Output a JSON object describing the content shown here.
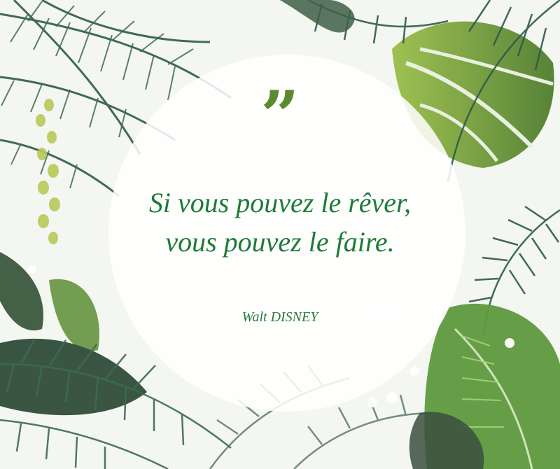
{
  "quote": {
    "mark": "”",
    "lines": [
      "Si vous pouvez le rêver,",
      "vous pouvez le faire."
    ],
    "author": "Walt DISNEY"
  },
  "colors": {
    "background": "#f4f6f1",
    "quote_text": "#1f7a3a",
    "quote_mark": "#5c8a2f",
    "circle": "#ffffff"
  },
  "decoration": {
    "frame": "tropical-foliage",
    "shape": "white-circle"
  }
}
